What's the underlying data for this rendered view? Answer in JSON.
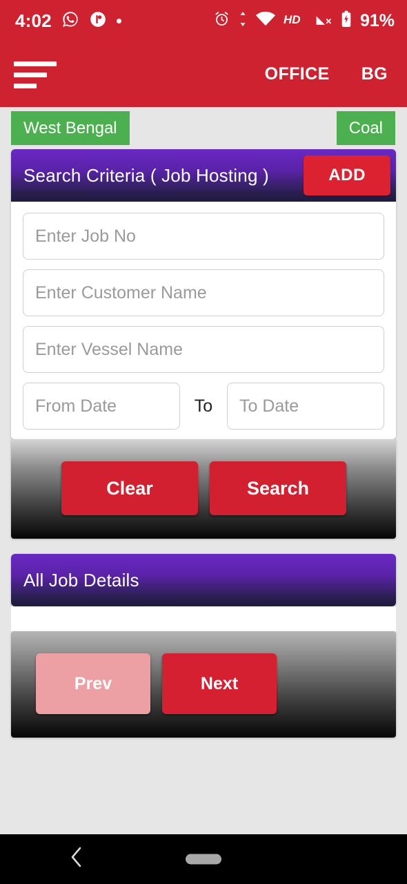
{
  "statusbar": {
    "time": "4:02",
    "battery": "91%",
    "left_icons": [
      "whatsapp-icon",
      "app-badge-icon",
      "dot-icon"
    ],
    "right_icons": [
      "alarm-icon",
      "data-transfer-icon",
      "wifi-icon",
      "hd-icon",
      "signal-off-icon",
      "battery-icon"
    ],
    "background": "#cf2230"
  },
  "appbar": {
    "menu_icon": "hamburger-menu-icon",
    "office_label": "OFFICE",
    "branch_label": "BG",
    "background": "#cf2230"
  },
  "chips": {
    "state": "West Bengal",
    "commodity": "Coal",
    "color": "#4caf50"
  },
  "search_card": {
    "title": "Search Criteria ( Job Hosting )",
    "add_label": "ADD",
    "header_gradient_from": "#6a28c4",
    "header_gradient_to": "#1d1b3d",
    "fields": {
      "job_no": {
        "value": "",
        "placeholder": "Enter Job No"
      },
      "customer_name": {
        "value": "",
        "placeholder": "Enter Customer Name"
      },
      "vessel_name": {
        "value": "",
        "placeholder": "Enter Vessel Name"
      },
      "from_date": {
        "value": "",
        "placeholder": "From Date"
      },
      "to_date": {
        "value": "",
        "placeholder": "To Date"
      }
    },
    "to_separator": "To",
    "clear_label": "Clear",
    "search_label": "Search"
  },
  "results_card": {
    "title": "All Job Details",
    "prev_label": "Prev",
    "next_label": "Next",
    "prev_disabled_color": "#eda0a4",
    "next_color": "#d42030"
  },
  "system_nav": {
    "back_icon": "chevron-left-icon",
    "home_pill": "home-pill-indicator"
  }
}
